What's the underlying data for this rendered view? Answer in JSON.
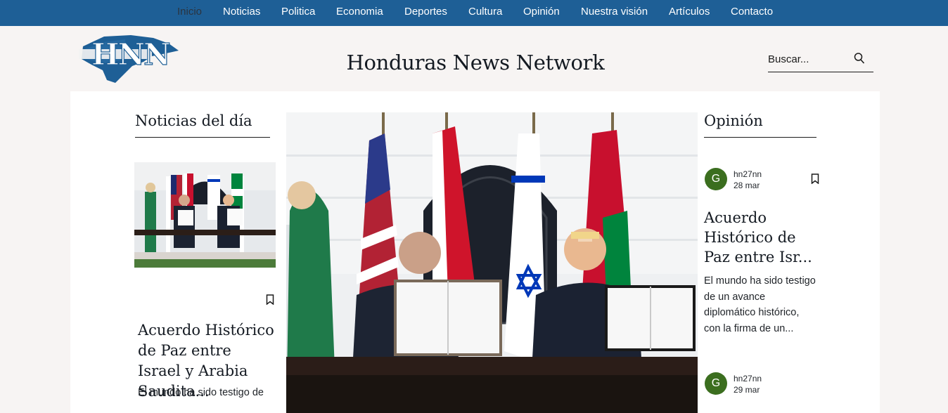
{
  "nav": {
    "items": [
      "Inicio",
      "Noticias",
      "Politica",
      "Economia",
      "Deportes",
      "Cultura",
      "Opinión",
      "Nuestra visión",
      "Artículos",
      "Contacto"
    ],
    "active_color": "#2b3440",
    "background": "#1e5f96"
  },
  "logo": {
    "text": "HNN",
    "icon": "honduras-map-logo"
  },
  "header": {
    "title": "Honduras News Network"
  },
  "search": {
    "placeholder": "Buscar...",
    "icon": "search-icon"
  },
  "news_of_day": {
    "title": "Noticias del día",
    "article": {
      "headline": "Acuerdo Histórico de Paz entre Israel y Arabia Saudita...",
      "excerpt": "El mundo ha sido testigo de",
      "bookmark_icon": "bookmark-icon"
    }
  },
  "hero": {
    "image": "signing-ceremony-photo"
  },
  "opinion": {
    "title": "Opinión",
    "posts": [
      {
        "avatar_letter": "G",
        "author": "hn27nn",
        "date": "28 mar",
        "headline": "Acuerdo Histórico de Paz entre Isr...",
        "excerpt": "El mundo ha sido testigo de un avance diplomático histórico, con la firma de un...",
        "bookmark_icon": "bookmark-icon"
      },
      {
        "avatar_letter": "G",
        "author": "hn27nn",
        "date": "29 mar"
      }
    ],
    "avatar_color": "#3b6e1f"
  }
}
